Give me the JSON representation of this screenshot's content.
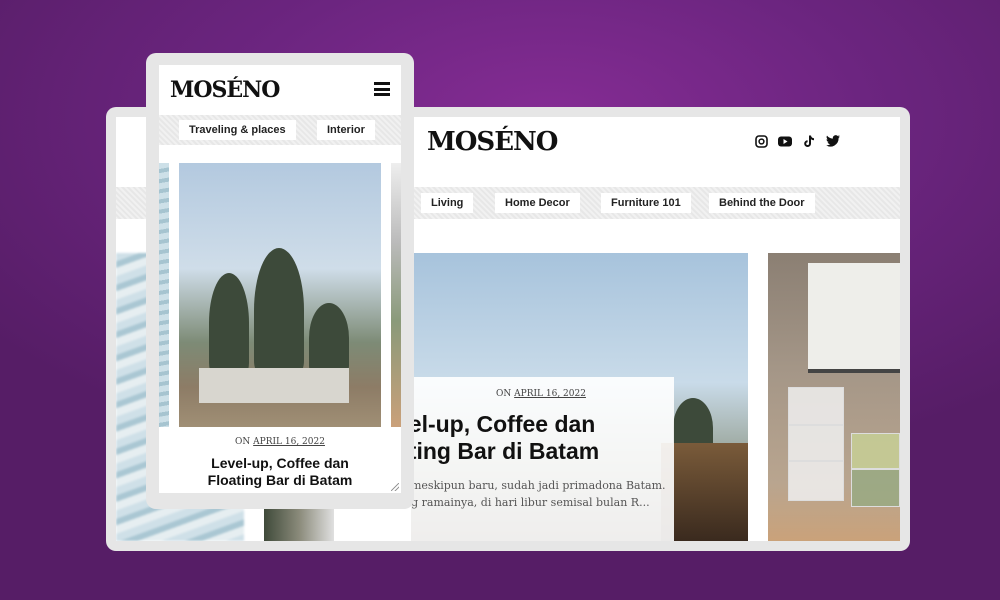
{
  "brand": {
    "logo": "MOSÉNO"
  },
  "desktop": {
    "socials": [
      {
        "name": "instagram",
        "icon": "instagram-icon"
      },
      {
        "name": "youtube",
        "icon": "youtube-icon"
      },
      {
        "name": "tiktok",
        "icon": "tiktok-icon"
      },
      {
        "name": "twitter",
        "icon": "twitter-icon"
      }
    ],
    "nav": [
      "Living",
      "Home Decor",
      "Furniture 101",
      "Behind the Door"
    ],
    "featured": {
      "date_prefix": "ON",
      "date": "APRIL 16, 2022",
      "title_line1": "vel-up, Coffee dan",
      "title_line2": "ating Bar di Batam",
      "excerpt_line1": ", meskipun baru, sudah jadi primadona Batam.",
      "excerpt_line2": "ng ramainya, di hari libur semisal bulan R..."
    }
  },
  "mobile": {
    "nav": [
      "Traveling & places",
      "Interior"
    ],
    "featured": {
      "date_prefix": "ON",
      "date": "APRIL 16, 2022",
      "title_line1": "Level-up, Coffee dan",
      "title_line2": "Floating Bar di Batam"
    }
  },
  "colors": {
    "background": "#6c2580",
    "frame": "#e6e6e6",
    "text": "#111111"
  }
}
